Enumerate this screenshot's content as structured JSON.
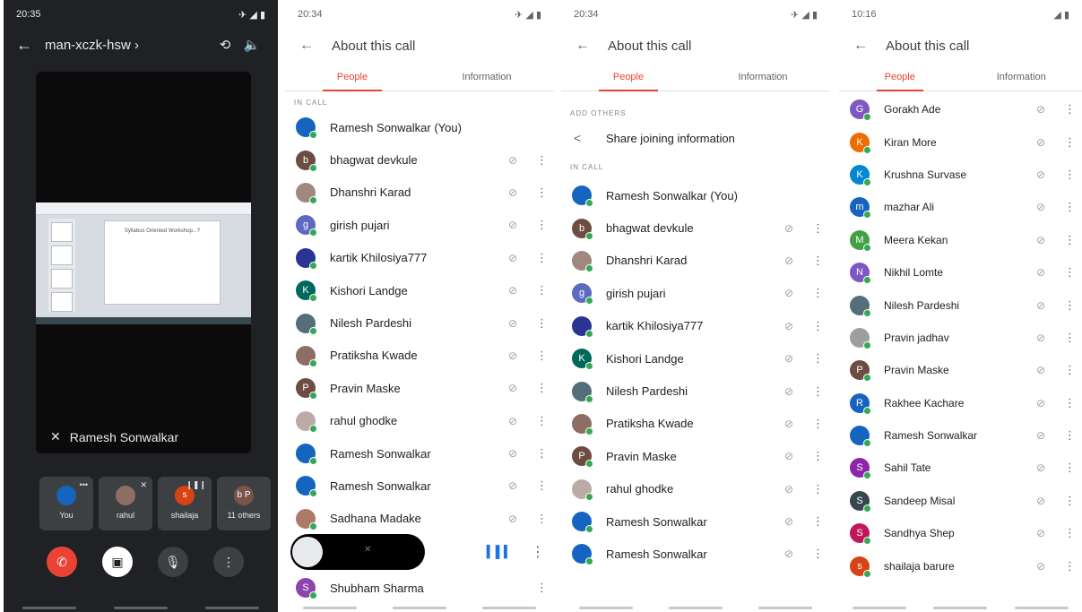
{
  "screen1": {
    "status_time": "20:35",
    "meeting_code": "man-xczk-hsw",
    "presenting_name": "Ramesh Sonwalkar",
    "slide_title": "Syllabus Oriented Workshop...?",
    "tiles": [
      {
        "label": "You",
        "color": "#1565c0",
        "letter": "",
        "mini": "•••"
      },
      {
        "label": "rahul",
        "color": "#8d6e63",
        "letter": "",
        "mini": "✕"
      },
      {
        "label": "shailaja",
        "color": "#d84315",
        "letter": "s",
        "mini": "❙❚❙"
      },
      {
        "label": "11 others",
        "color": "#795548",
        "letter": "b P",
        "mini": ""
      }
    ]
  },
  "screen2": {
    "status_time": "20:34",
    "title": "About this call",
    "tab_people": "People",
    "tab_info": "Information",
    "section_in_call": "IN CALL",
    "people": [
      {
        "name": "Ramesh Sonwalkar (You)",
        "color": "#1565c0",
        "letter": "",
        "you": true
      },
      {
        "name": "bhagwat devkule",
        "color": "#6d4c41",
        "letter": "b"
      },
      {
        "name": "Dhanshri Karad",
        "color": "#a1887f",
        "letter": ""
      },
      {
        "name": "girish pujari",
        "color": "#5c6bc0",
        "letter": "g"
      },
      {
        "name": "kartik Khilosiya777",
        "color": "#283593",
        "letter": ""
      },
      {
        "name": "Kishori Landge",
        "color": "#00695c",
        "letter": "K"
      },
      {
        "name": "Nilesh Pardeshi",
        "color": "#546e7a",
        "letter": ""
      },
      {
        "name": "Pratiksha Kwade",
        "color": "#8d6e63",
        "letter": ""
      },
      {
        "name": "Pravin Maske",
        "color": "#6d4c41",
        "letter": "P"
      },
      {
        "name": "rahul ghodke",
        "color": "#bcaaa4",
        "letter": ""
      },
      {
        "name": "Ramesh Sonwalkar",
        "color": "#1565c0",
        "letter": ""
      },
      {
        "name": "Ramesh Sonwalkar",
        "color": "#1565c0",
        "letter": ""
      },
      {
        "name": "Sadhana Madake",
        "color": "#ad7a6a",
        "letter": ""
      }
    ],
    "last_person": {
      "name": "Shubham Sharma",
      "color": "#8e44ad",
      "letter": "S"
    }
  },
  "screen3": {
    "status_time": "20:34",
    "title": "About this call",
    "tab_people": "People",
    "tab_info": "Information",
    "section_add": "ADD OTHERS",
    "share_label": "Share joining information",
    "section_in_call": "IN CALL",
    "people": [
      {
        "name": "Ramesh Sonwalkar (You)",
        "color": "#1565c0",
        "letter": "",
        "you": true
      },
      {
        "name": "bhagwat devkule",
        "color": "#6d4c41",
        "letter": "b"
      },
      {
        "name": "Dhanshri Karad",
        "color": "#a1887f",
        "letter": ""
      },
      {
        "name": "girish pujari",
        "color": "#5c6bc0",
        "letter": "g"
      },
      {
        "name": "kartik Khilosiya777",
        "color": "#283593",
        "letter": ""
      },
      {
        "name": "Kishori Landge",
        "color": "#00695c",
        "letter": "K"
      },
      {
        "name": "Nilesh Pardeshi",
        "color": "#546e7a",
        "letter": ""
      },
      {
        "name": "Pratiksha Kwade",
        "color": "#8d6e63",
        "letter": ""
      },
      {
        "name": "Pravin Maske",
        "color": "#6d4c41",
        "letter": "P"
      },
      {
        "name": "rahul ghodke",
        "color": "#bcaaa4",
        "letter": ""
      },
      {
        "name": "Ramesh Sonwalkar",
        "color": "#1565c0",
        "letter": ""
      },
      {
        "name": "Ramesh Sonwalkar",
        "color": "#1565c0",
        "letter": ""
      }
    ]
  },
  "screen4": {
    "status_time": "10:16",
    "title": "About this call",
    "tab_people": "People",
    "tab_info": "Information",
    "people": [
      {
        "name": "Gorakh Ade",
        "color": "#7e57c2",
        "letter": "G"
      },
      {
        "name": "Kiran More",
        "color": "#ef6c00",
        "letter": "K"
      },
      {
        "name": "Krushna Survase",
        "color": "#0288d1",
        "letter": "K"
      },
      {
        "name": "mazhar Ali",
        "color": "#1565c0",
        "letter": "m"
      },
      {
        "name": "Meera Kekan",
        "color": "#43a047",
        "letter": "M"
      },
      {
        "name": "Nikhil Lomte",
        "color": "#7e57c2",
        "letter": "N"
      },
      {
        "name": "Nilesh Pardeshi",
        "color": "#546e7a",
        "letter": ""
      },
      {
        "name": "Pravin jadhav",
        "color": "#9e9e9e",
        "letter": ""
      },
      {
        "name": "Pravin Maske",
        "color": "#6d4c41",
        "letter": "P"
      },
      {
        "name": "Rakhee Kachare",
        "color": "#1565c0",
        "letter": "R"
      },
      {
        "name": "Ramesh Sonwalkar",
        "color": "#1565c0",
        "letter": ""
      },
      {
        "name": "Sahil Tate",
        "color": "#8e24aa",
        "letter": "S"
      },
      {
        "name": "Sandeep Misal",
        "color": "#37474f",
        "letter": "S"
      },
      {
        "name": "Sandhya Shep",
        "color": "#c2185b",
        "letter": "S"
      },
      {
        "name": "shailaja barure",
        "color": "#d84315",
        "letter": "s"
      }
    ]
  }
}
